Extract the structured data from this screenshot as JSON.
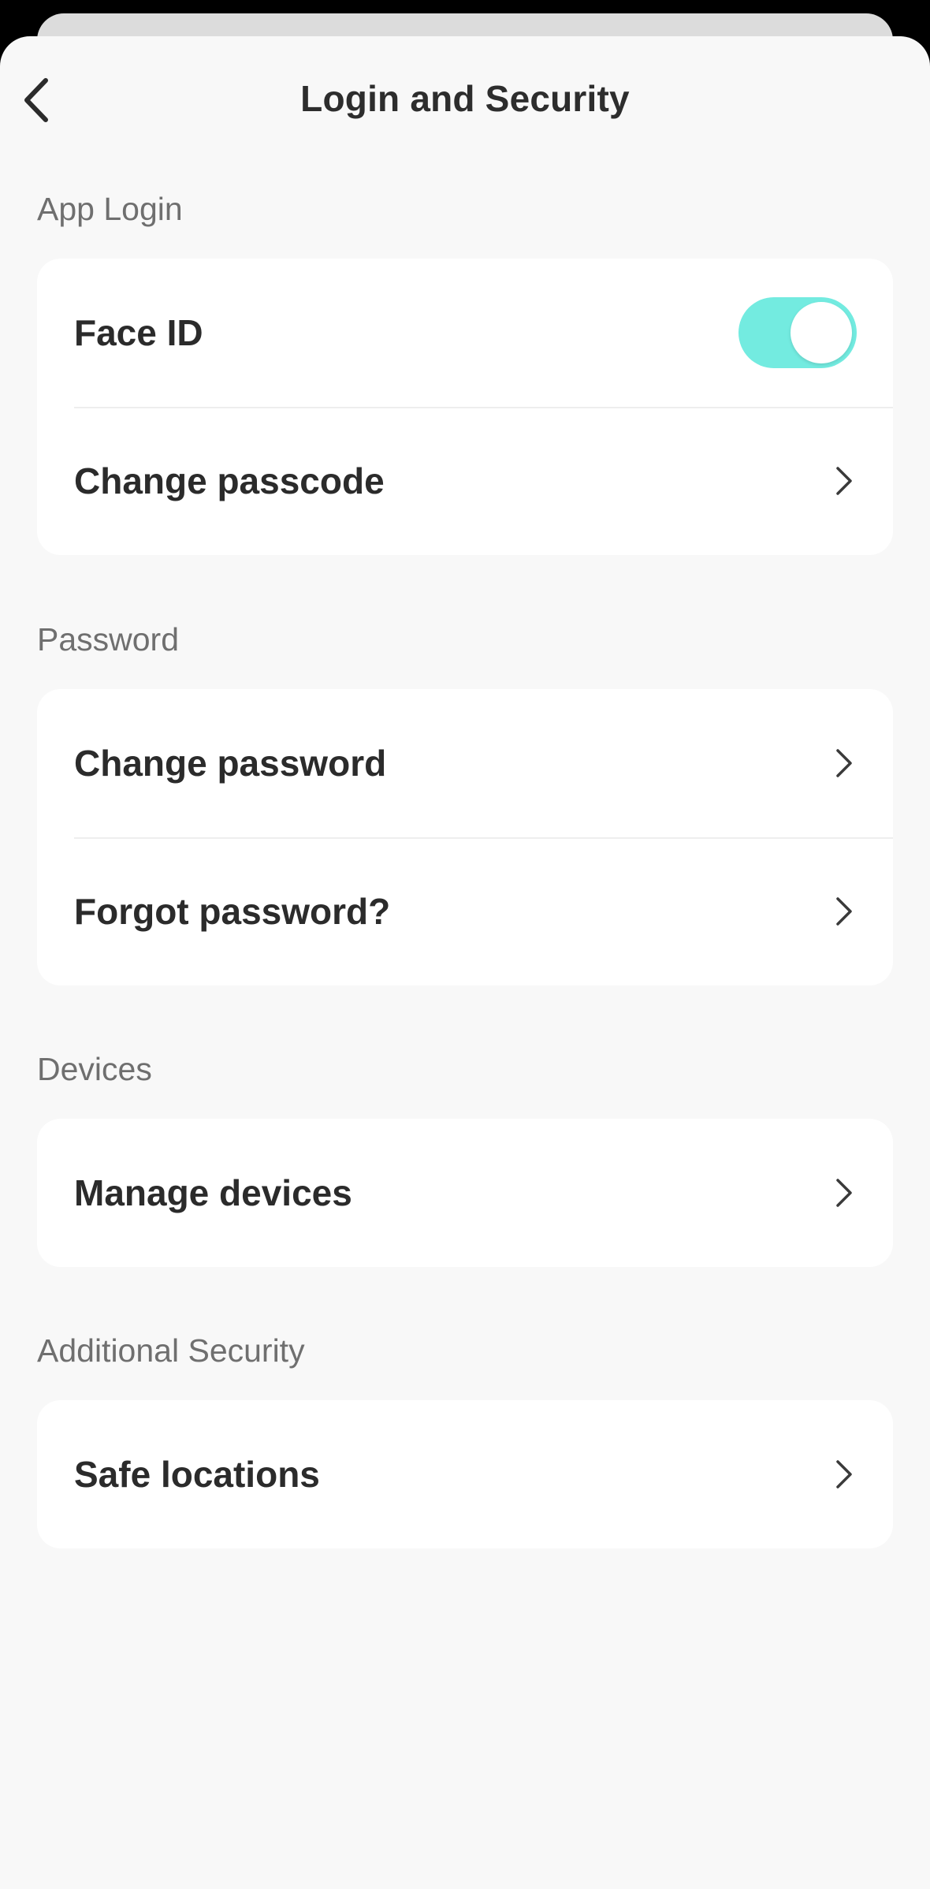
{
  "header": {
    "title": "Login and Security",
    "back_icon": "chevron-left-icon"
  },
  "sections": [
    {
      "label": "App Login",
      "items": [
        {
          "label": "Face ID",
          "control": "toggle",
          "toggle_on": true
        },
        {
          "label": "Change passcode",
          "control": "chevron"
        }
      ]
    },
    {
      "label": "Password",
      "items": [
        {
          "label": "Change password",
          "control": "chevron"
        },
        {
          "label": "Forgot password?",
          "control": "chevron"
        }
      ]
    },
    {
      "label": "Devices",
      "items": [
        {
          "label": "Manage devices",
          "control": "chevron"
        }
      ]
    },
    {
      "label": "Additional Security",
      "items": [
        {
          "label": "Safe locations",
          "control": "chevron"
        }
      ]
    }
  ],
  "colors": {
    "accent_toggle": "#73ebe0",
    "background": "#f8f8f8",
    "card": "#ffffff",
    "section_label": "#6f6f6f",
    "text": "#2b2b2b"
  }
}
